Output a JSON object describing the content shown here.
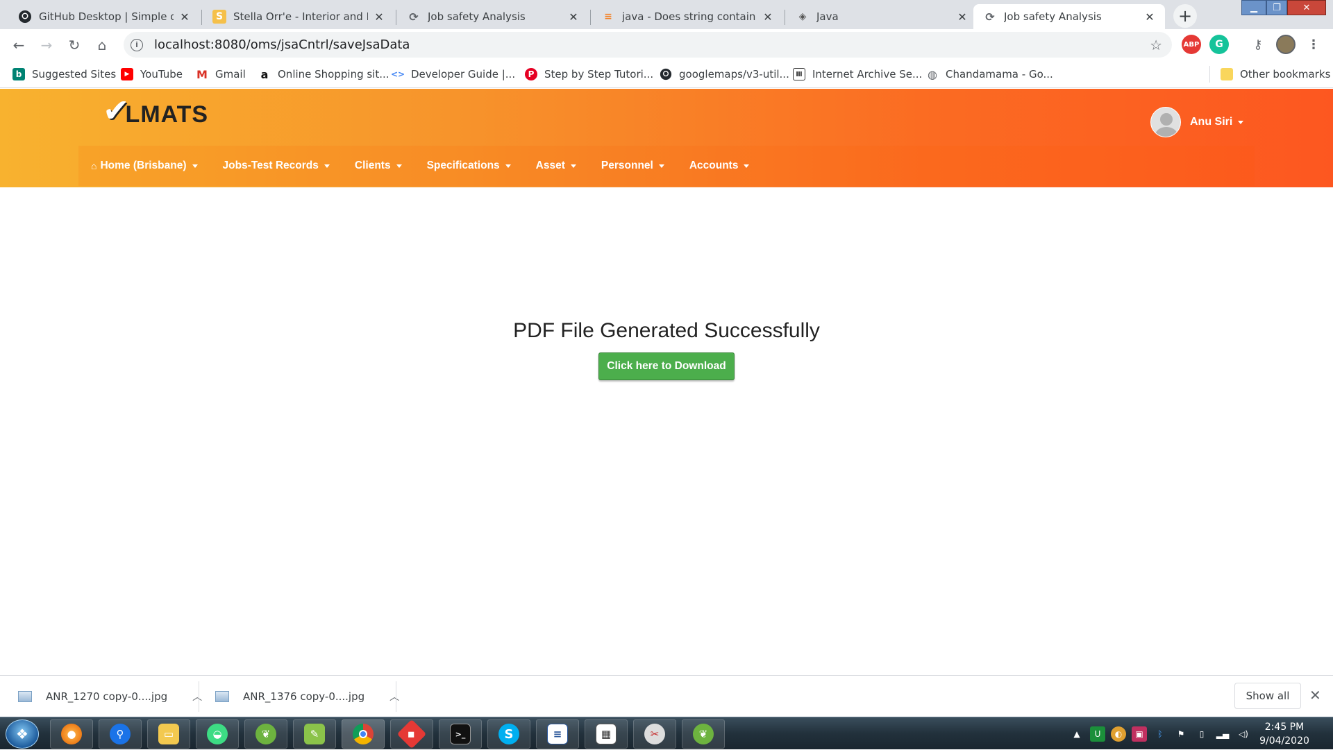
{
  "browser": {
    "tabs": [
      {
        "title": "GitHub Desktop | Simple colla",
        "icon": "github-icon",
        "active": false
      },
      {
        "title": "Stella Orr'e - Interior and Hom",
        "icon": "s-icon",
        "active": false
      },
      {
        "title": "Job safety Analysis",
        "icon": "loading-icon",
        "active": false
      },
      {
        "title": "java - Does string contain thre",
        "icon": "stackoverflow-icon",
        "active": false
      },
      {
        "title": "Java",
        "icon": "java-icon",
        "active": false
      },
      {
        "title": "Job safety Analysis",
        "icon": "loading-icon",
        "active": true
      }
    ],
    "url": "localhost:8080/oms/jsaCntrl/saveJsaData",
    "bookmarks": [
      {
        "label": "Suggested Sites",
        "icon": "bing-icon"
      },
      {
        "label": "YouTube",
        "icon": "youtube-icon"
      },
      {
        "label": "Gmail",
        "icon": "gmail-icon"
      },
      {
        "label": "Online Shopping sit...",
        "icon": "amazon-icon"
      },
      {
        "label": "Developer Guide  |...",
        "icon": "code-icon"
      },
      {
        "label": "Step by Step Tutori...",
        "icon": "pinterest-icon"
      },
      {
        "label": "googlemaps/v3-util...",
        "icon": "github-icon"
      },
      {
        "label": "Internet Archive Se...",
        "icon": "archive-icon"
      },
      {
        "label": "Chandamama - Go...",
        "icon": "globe-icon"
      }
    ],
    "other_bookmarks": "Other bookmarks"
  },
  "app": {
    "logo_text": "LMATS",
    "user_name": "Anu Siri",
    "menu": [
      {
        "label": "Home (Brisbane)"
      },
      {
        "label": "Jobs-Test Records"
      },
      {
        "label": "Clients"
      },
      {
        "label": "Specifications"
      },
      {
        "label": "Asset"
      },
      {
        "label": "Personnel"
      },
      {
        "label": "Accounts"
      }
    ],
    "colors": {
      "header_start": "#f8b22f",
      "header_end": "#fd5720",
      "button": "#4cae4c"
    }
  },
  "main": {
    "message": "PDF File Generated Successfully",
    "download_button": "Click here to Download"
  },
  "downloads": {
    "items": [
      {
        "name": "ANR_1270 copy-0....jpg"
      },
      {
        "name": "ANR_1376 copy-0....jpg"
      }
    ],
    "show_all": "Show all"
  },
  "taskbar": {
    "time": "2:45 PM",
    "date": "9/04/2020"
  }
}
